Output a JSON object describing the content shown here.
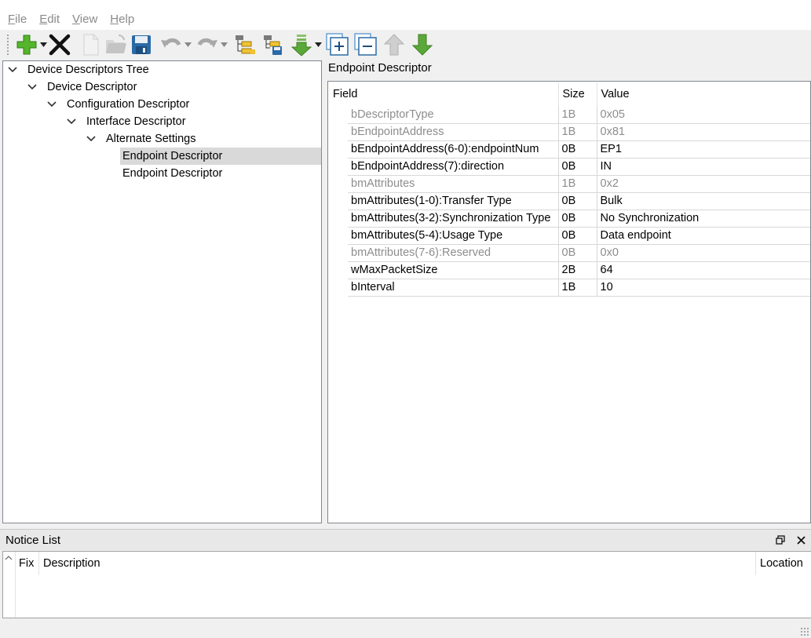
{
  "menu": {
    "items": [
      {
        "mnemonic": "F",
        "rest": "ile"
      },
      {
        "mnemonic": "E",
        "rest": "dit"
      },
      {
        "mnemonic": "V",
        "rest": "iew"
      },
      {
        "mnemonic": "H",
        "rest": "elp"
      }
    ]
  },
  "toolbar": {
    "icons": [
      "add-icon",
      "delete-icon",
      "new-file-icon",
      "open-folder-icon",
      "save-icon",
      "undo-icon",
      "redo-icon",
      "tree-add-icon",
      "tree-save-icon",
      "move-down-dropdown-icon",
      "expand-all-icon",
      "collapse-all-icon",
      "move-up-icon",
      "move-down-icon"
    ],
    "accent_green": "#4caf2a"
  },
  "tree": {
    "nodes": [
      {
        "label": "Device Descriptors Tree",
        "expanded": true
      },
      {
        "label": "Device Descriptor",
        "expanded": true
      },
      {
        "label": "Configuration Descriptor",
        "expanded": true
      },
      {
        "label": "Interface Descriptor",
        "expanded": true
      },
      {
        "label": "Alternate Settings",
        "expanded": true
      },
      {
        "label": "Endpoint Descriptor",
        "selected": true
      },
      {
        "label": "Endpoint Descriptor"
      }
    ]
  },
  "panel": {
    "title": "Endpoint Descriptor",
    "columns": {
      "field": "Field",
      "size": "Size",
      "value": "Value"
    },
    "rows": [
      {
        "field": "bDescriptorType",
        "size": "1B",
        "value": "0x05",
        "readonly": true
      },
      {
        "field": "bEndpointAddress",
        "size": "1B",
        "value": "0x81",
        "readonly": true
      },
      {
        "field": "bEndpointAddress(6-0):endpointNum",
        "size": "0B",
        "value": "EP1",
        "readonly": false
      },
      {
        "field": "bEndpointAddress(7):direction",
        "size": "0B",
        "value": "IN",
        "readonly": false
      },
      {
        "field": "bmAttributes",
        "size": "1B",
        "value": "0x2",
        "readonly": true
      },
      {
        "field": "bmAttributes(1-0):Transfer Type",
        "size": "0B",
        "value": "Bulk",
        "readonly": false
      },
      {
        "field": "bmAttributes(3-2):Synchronization Type",
        "size": "0B",
        "value": "No Synchronization",
        "readonly": false
      },
      {
        "field": "bmAttributes(5-4):Usage Type",
        "size": "0B",
        "value": "Data endpoint",
        "readonly": false
      },
      {
        "field": "bmAttributes(7-6):Reserved",
        "size": "0B",
        "value": "0x0",
        "readonly": true
      },
      {
        "field": "wMaxPacketSize",
        "size": "2B",
        "value": "64",
        "readonly": false
      },
      {
        "field": "bInterval",
        "size": "1B",
        "value": "10",
        "readonly": false
      }
    ]
  },
  "notice": {
    "title": "Notice List",
    "columns": {
      "fix": "Fix",
      "description": "Description",
      "location": "Location"
    }
  }
}
